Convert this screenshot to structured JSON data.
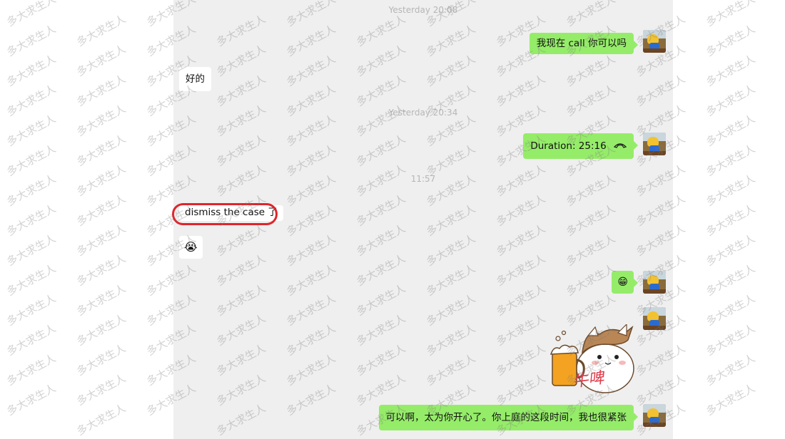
{
  "watermark_text": "多大求生人",
  "colors": {
    "panel_bg": "#efefef",
    "my_bubble": "#95ec69",
    "their_bubble": "#ffffff",
    "highlight": "#e0252b"
  },
  "timestamps": [
    "Yesterday 20:08",
    "Yesterday 20:34",
    "11:57"
  ],
  "messages": {
    "m1": {
      "text": "我现在 call 你可以吗"
    },
    "m2": {
      "text": "好的"
    },
    "m3": {
      "text": "Duration: 25:16",
      "icon": "phone-icon"
    },
    "m4": {
      "text": "dismiss the case 了"
    },
    "m5": {
      "emoji": "😭"
    },
    "m6": {
      "emoji": "😁"
    },
    "m7": {
      "sticker_text": "牛啤"
    },
    "m8": {
      "text": "可以啊，太为你开心了。你上庭的这段时间，我也很紧张"
    }
  }
}
